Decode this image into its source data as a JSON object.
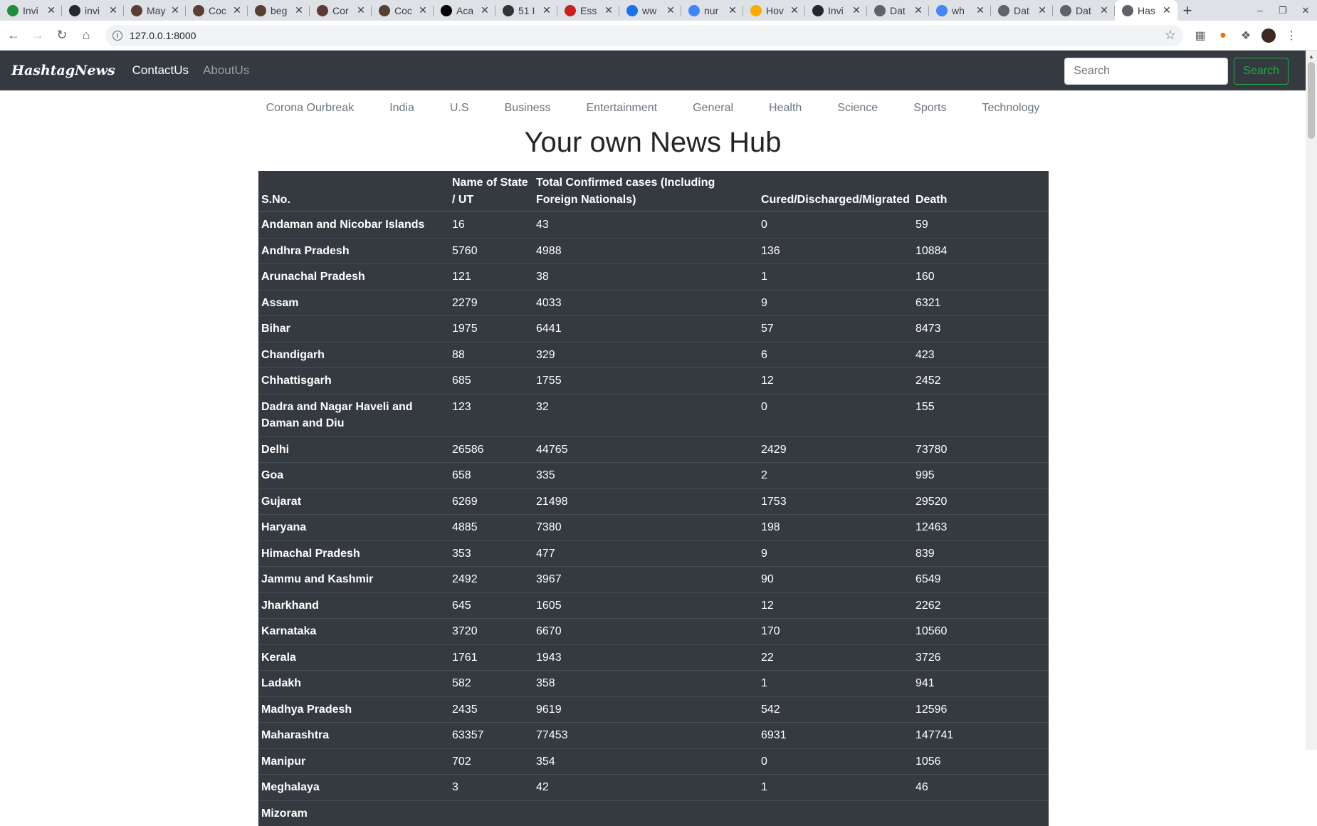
{
  "browser": {
    "tabs": [
      {
        "label": "Invi",
        "icon": "infinity-icon",
        "color": "#1e8e3e"
      },
      {
        "label": "invi",
        "icon": "github-icon",
        "color": "#24292e"
      },
      {
        "label": "May",
        "icon": "cc-icon",
        "color": "#5a3e36"
      },
      {
        "label": "Coc",
        "icon": "cc-icon",
        "color": "#5a3e36"
      },
      {
        "label": "beg",
        "icon": "cc-icon",
        "color": "#5a3e36"
      },
      {
        "label": "Cor",
        "icon": "cc-icon",
        "color": "#5a3e36"
      },
      {
        "label": "Coc",
        "icon": "cc-icon",
        "color": "#5a3e36"
      },
      {
        "label": "Aca",
        "icon": "a-icon",
        "color": "#000000"
      },
      {
        "label": "51 I",
        "icon": "gg-icon",
        "color": "#333333"
      },
      {
        "label": "Ess",
        "icon": "doc-icon",
        "color": "#c5221f"
      },
      {
        "label": "ww",
        "icon": "doc-icon",
        "color": "#1a73e8"
      },
      {
        "label": "nur",
        "icon": "google-icon",
        "color": "#4285f4"
      },
      {
        "label": "Hov",
        "icon": "bee-icon",
        "color": "#f9ab00"
      },
      {
        "label": "Invi",
        "icon": "github-icon",
        "color": "#24292e"
      },
      {
        "label": "Dat",
        "icon": "globe-icon",
        "color": "#5f6368"
      },
      {
        "label": "wh",
        "icon": "google-icon",
        "color": "#4285f4"
      },
      {
        "label": "Dat",
        "icon": "globe-icon",
        "color": "#5f6368"
      },
      {
        "label": "Dat",
        "icon": "globe-icon",
        "color": "#5f6368"
      },
      {
        "label": "Has",
        "icon": "globe-icon",
        "color": "#5f6368",
        "active": true
      }
    ],
    "url": "127.0.0.1:8000"
  },
  "navbar": {
    "brand": "HashtagNews",
    "links": [
      "ContactUs",
      "AboutUs"
    ],
    "search_placeholder": "Search",
    "search_button": "Search"
  },
  "categories": [
    "Corona Ourbreak",
    "India",
    "U.S",
    "Business",
    "Entertainment",
    "General",
    "Health",
    "Science",
    "Sports",
    "Technology"
  ],
  "page_title": "Your own News Hub",
  "table": {
    "headers": [
      "S.No.",
      "Name of State / UT",
      "Total Confirmed cases (Including Foreign Nationals)",
      "Cured/Discharged/Migrated",
      "Death"
    ],
    "rows": [
      [
        "Andaman and Nicobar Islands",
        "16",
        "43",
        "0",
        "59"
      ],
      [
        "Andhra Pradesh",
        "5760",
        "4988",
        "136",
        "10884"
      ],
      [
        "Arunachal Pradesh",
        "121",
        "38",
        "1",
        "160"
      ],
      [
        "Assam",
        "2279",
        "4033",
        "9",
        "6321"
      ],
      [
        "Bihar",
        "1975",
        "6441",
        "57",
        "8473"
      ],
      [
        "Chandigarh",
        "88",
        "329",
        "6",
        "423"
      ],
      [
        "Chhattisgarh",
        "685",
        "1755",
        "12",
        "2452"
      ],
      [
        "Dadra and Nagar Haveli and Daman and Diu",
        "123",
        "32",
        "0",
        "155"
      ],
      [
        "Delhi",
        "26586",
        "44765",
        "2429",
        "73780"
      ],
      [
        "Goa",
        "658",
        "335",
        "2",
        "995"
      ],
      [
        "Gujarat",
        "6269",
        "21498",
        "1753",
        "29520"
      ],
      [
        "Haryana",
        "4885",
        "7380",
        "198",
        "12463"
      ],
      [
        "Himachal Pradesh",
        "353",
        "477",
        "9",
        "839"
      ],
      [
        "Jammu and Kashmir",
        "2492",
        "3967",
        "90",
        "6549"
      ],
      [
        "Jharkhand",
        "645",
        "1605",
        "12",
        "2262"
      ],
      [
        "Karnataka",
        "3720",
        "6670",
        "170",
        "10560"
      ],
      [
        "Kerala",
        "1761",
        "1943",
        "22",
        "3726"
      ],
      [
        "Ladakh",
        "582",
        "358",
        "1",
        "941"
      ],
      [
        "Madhya Pradesh",
        "2435",
        "9619",
        "542",
        "12596"
      ],
      [
        "Maharashtra",
        "63357",
        "77453",
        "6931",
        "147741"
      ],
      [
        "Manipur",
        "702",
        "354",
        "0",
        "1056"
      ],
      [
        "Meghalaya",
        "3",
        "42",
        "1",
        "46"
      ],
      [
        "Mizoram",
        "",
        "",
        "",
        ""
      ]
    ]
  }
}
